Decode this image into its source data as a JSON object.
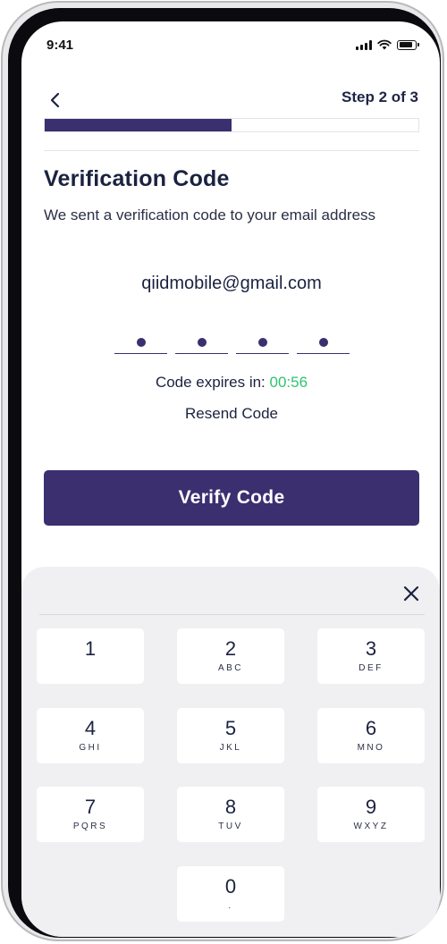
{
  "status_bar": {
    "time": "9:41",
    "icons": [
      "signal-icon",
      "wifi-icon",
      "battery-icon"
    ]
  },
  "header": {
    "back_icon": "chevron-left-icon",
    "step_label": "Step 2 of 3",
    "progress_fraction": 0.5
  },
  "content": {
    "title": "Verification Code",
    "subtitle": "We sent a verification code to your email address",
    "email": "qiidmobile@gmail.com",
    "code_length": 4,
    "expires_label": "Code expires in: ",
    "expires_timer": "00:56",
    "resend_label": "Resend Code",
    "verify_button_label": "Verify Code"
  },
  "keypad": {
    "close_icon": "close-icon",
    "keys": [
      {
        "digit": "1",
        "letters": ""
      },
      {
        "digit": "2",
        "letters": "ABC"
      },
      {
        "digit": "3",
        "letters": "DEF"
      },
      {
        "digit": "4",
        "letters": "GHI"
      },
      {
        "digit": "5",
        "letters": "JKL"
      },
      {
        "digit": "6",
        "letters": "MNO"
      },
      {
        "digit": "7",
        "letters": "PQRS"
      },
      {
        "digit": "8",
        "letters": "TUV"
      },
      {
        "digit": "9",
        "letters": "WXYZ"
      },
      {
        "digit": "0",
        "letters": "."
      }
    ]
  },
  "colors": {
    "primary": "#3c2f70",
    "timer": "#2ec46f",
    "text": "#1b2240",
    "keypad_background": "#f0f0f3"
  }
}
